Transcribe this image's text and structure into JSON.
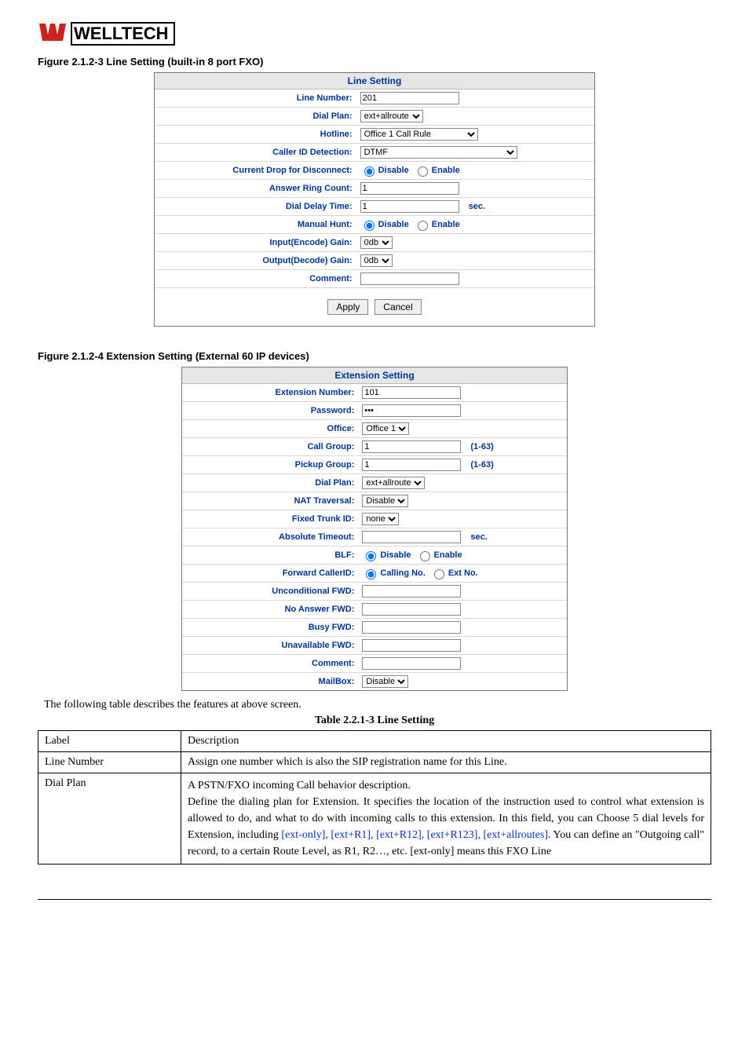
{
  "logo": {
    "text": "WELLTECH"
  },
  "figureA": {
    "title": "Figure    2.1.2-3 Line Setting (built-in 8 port FXO)",
    "panelTitle": "Line Setting",
    "rows": {
      "lineNumber": {
        "label": "Line Number:",
        "value": "201"
      },
      "dialPlan": {
        "label": "Dial Plan:",
        "value": "ext+allroute"
      },
      "hotline": {
        "label": "Hotline:",
        "value": "Office 1 Call Rule"
      },
      "callerId": {
        "label": "Caller ID Detection:",
        "value": "DTMF"
      },
      "dropDisc": {
        "label": "Current Drop for Disconnect:",
        "disable": "Disable",
        "enable": "Enable"
      },
      "ansRing": {
        "label": "Answer Ring Count:",
        "value": "1"
      },
      "dialDelay": {
        "label": "Dial Delay Time:",
        "value": "1",
        "suffix": "sec."
      },
      "manualHunt": {
        "label": "Manual Hunt:",
        "disable": "Disable",
        "enable": "Enable"
      },
      "inputGain": {
        "label": "Input(Encode) Gain:",
        "value": "0db"
      },
      "outputGain": {
        "label": "Output(Decode) Gain:",
        "value": "0db"
      },
      "comment": {
        "label": "Comment:",
        "value": ""
      }
    },
    "buttons": {
      "apply": "Apply",
      "cancel": "Cancel"
    }
  },
  "figureB": {
    "title": "Figure    2.1.2-4 Extension Setting (External 60 IP devices)",
    "panelTitle": "Extension Setting",
    "rows": {
      "extNum": {
        "label": "Extension Number:",
        "value": "101"
      },
      "password": {
        "label": "Password:",
        "value": "•••"
      },
      "office": {
        "label": "Office:",
        "value": "Office 1"
      },
      "callGroup": {
        "label": "Call Group:",
        "value": "1",
        "suffix": "(1-63)"
      },
      "pickupGroup": {
        "label": "Pickup Group:",
        "value": "1",
        "suffix": "(1-63)"
      },
      "dialPlan": {
        "label": "Dial Plan:",
        "value": "ext+allroute"
      },
      "natTrav": {
        "label": "NAT Traversal:",
        "value": "Disable"
      },
      "fixedTrunk": {
        "label": "Fixed Trunk ID:",
        "value": "none"
      },
      "absTimeout": {
        "label": "Absolute Timeout:",
        "value": "",
        "suffix": "sec."
      },
      "blf": {
        "label": "BLF:",
        "disable": "Disable",
        "enable": "Enable"
      },
      "fwdCaller": {
        "label": "Forward CallerID:",
        "opt1": "Calling No.",
        "opt2": "Ext No."
      },
      "uncondFwd": {
        "label": "Unconditional FWD:",
        "value": ""
      },
      "noAnsFwd": {
        "label": "No Answer FWD:",
        "value": ""
      },
      "busyFwd": {
        "label": "Busy FWD:",
        "value": ""
      },
      "unavailFwd": {
        "label": "Unavailable FWD:",
        "value": ""
      },
      "comment": {
        "label": "Comment:",
        "value": ""
      },
      "mailbox": {
        "label": "MailBox:",
        "value": "Disable"
      }
    }
  },
  "bodyText": "The following table describes the features at above screen.",
  "tableTitle": "Table 2.2.1-3 Line Setting",
  "descTable": {
    "header": {
      "label": "Label",
      "desc": "Description"
    },
    "lineNumber": {
      "label": "Line Number",
      "desc": "Assign one number which is also the SIP registration name for this Line."
    },
    "dialPlan": {
      "label": "Dial Plan",
      "p1": "A PSTN/FXO incoming Call behavior description.",
      "p2": "Define the dialing plan for Extension. It specifies the location of the instruction used to control what extension is allowed to do, and what to do with incoming calls to this extension. In this field, you can Choose 5 dial levels for Extension, including ",
      "link": "[ext-only], [ext+R1], [ext+R12], [ext+R123], [ext+allroutes]",
      "p3": ". You can define an \"Outgoing call\" record, to a certain Route Level, as R1, R2…, etc. [ext-only] means this FXO Line"
    }
  }
}
